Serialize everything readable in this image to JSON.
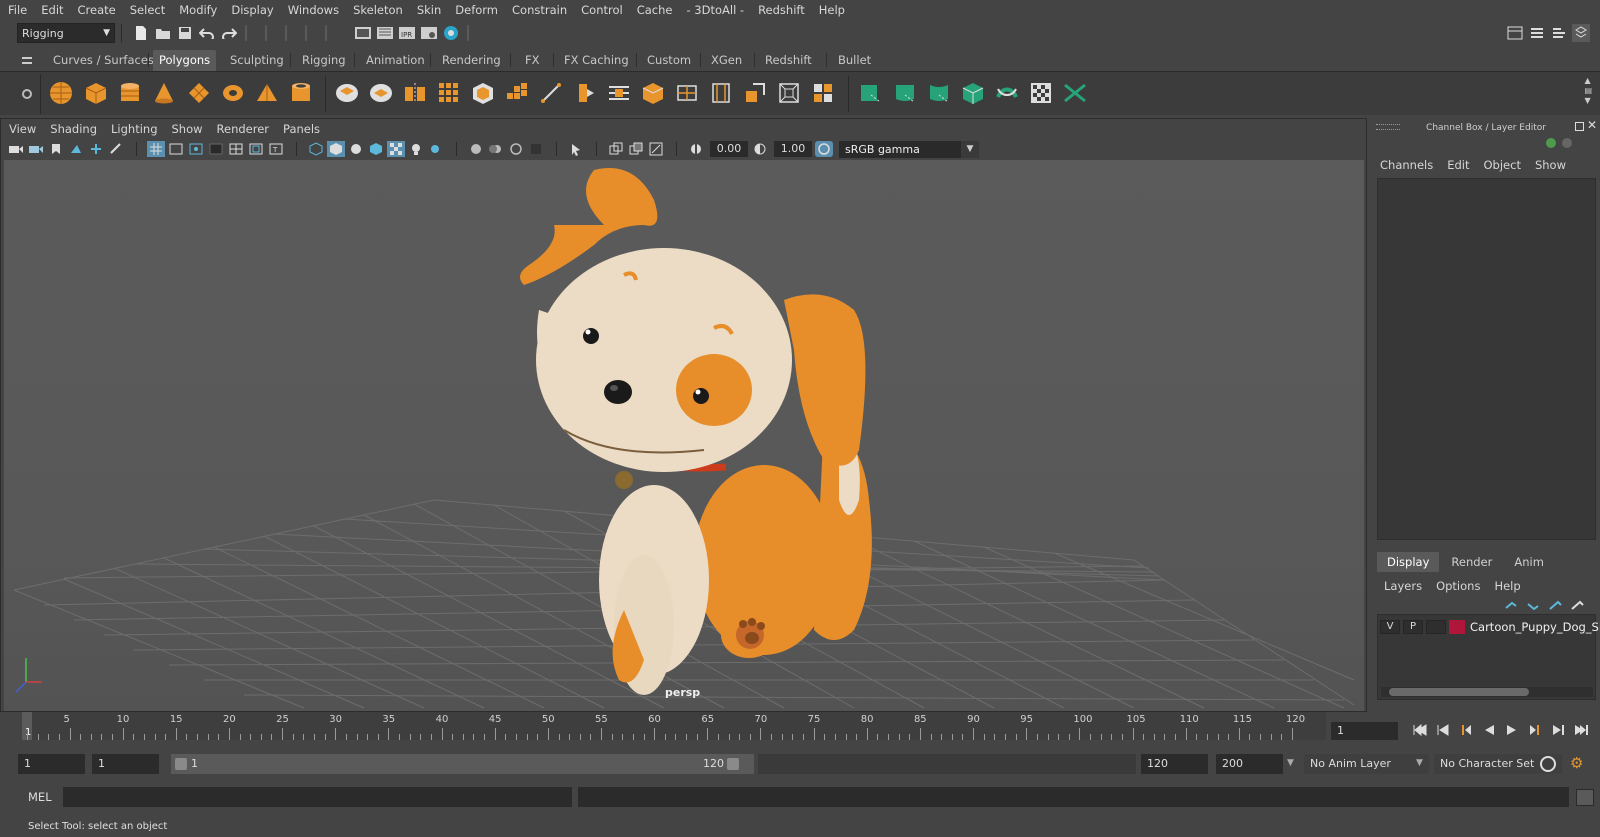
{
  "menubar": [
    "File",
    "Edit",
    "Create",
    "Select",
    "Modify",
    "Display",
    "Windows",
    "Skeleton",
    "Skin",
    "Deform",
    "Constrain",
    "Control",
    "Cache",
    "- 3DtoAll -",
    "Redshift",
    "Help"
  ],
  "statusline": {
    "mode": "Rigging"
  },
  "shelf": {
    "tabs": [
      "Curves / Surfaces",
      "Polygons",
      "Sculpting",
      "Rigging",
      "Animation",
      "Rendering",
      "FX",
      "FX Caching",
      "Custom",
      "XGen",
      "Redshift",
      "Bullet"
    ],
    "active_tab": "Polygons"
  },
  "viewport": {
    "menu": [
      "View",
      "Shading",
      "Lighting",
      "Show",
      "Renderer",
      "Panels"
    ],
    "exposure": "0.00",
    "gamma": "1.00",
    "color_space": "sRGB gamma",
    "camera_label": "persp"
  },
  "channel_box": {
    "title": "Channel Box / Layer Editor",
    "menu": [
      "Channels",
      "Edit",
      "Object",
      "Show"
    ]
  },
  "layer_editor": {
    "tabs": [
      "Display",
      "Render",
      "Anim"
    ],
    "active_tab": "Display",
    "menu": [
      "Layers",
      "Options",
      "Help"
    ],
    "layers": [
      {
        "visible": "V",
        "playback": "P",
        "color": "#b0163a",
        "name": "Cartoon_Puppy_Dog_Sit"
      }
    ]
  },
  "timeline": {
    "ticks": [
      "1",
      "5",
      "10",
      "15",
      "20",
      "25",
      "30",
      "35",
      "40",
      "45",
      "50",
      "55",
      "60",
      "65",
      "70",
      "75",
      "80",
      "85",
      "90",
      "95",
      "100",
      "105",
      "110",
      "115",
      "120"
    ],
    "current_frame": "1"
  },
  "range": {
    "anim_start": "1",
    "playback_start": "1",
    "slider_start": "1",
    "slider_end": "120",
    "playback_end": "120",
    "anim_end": "200",
    "anim_layer": "No Anim Layer",
    "character_set": "No Character Set"
  },
  "command_line": {
    "label": "MEL"
  },
  "help_line": "Select Tool: select an object",
  "colors": {
    "bg": "#444444",
    "viewport": "#595959",
    "accent": "#5a5a5a",
    "layer_color": "#b0163a",
    "shelf_green": "#27a37a"
  }
}
